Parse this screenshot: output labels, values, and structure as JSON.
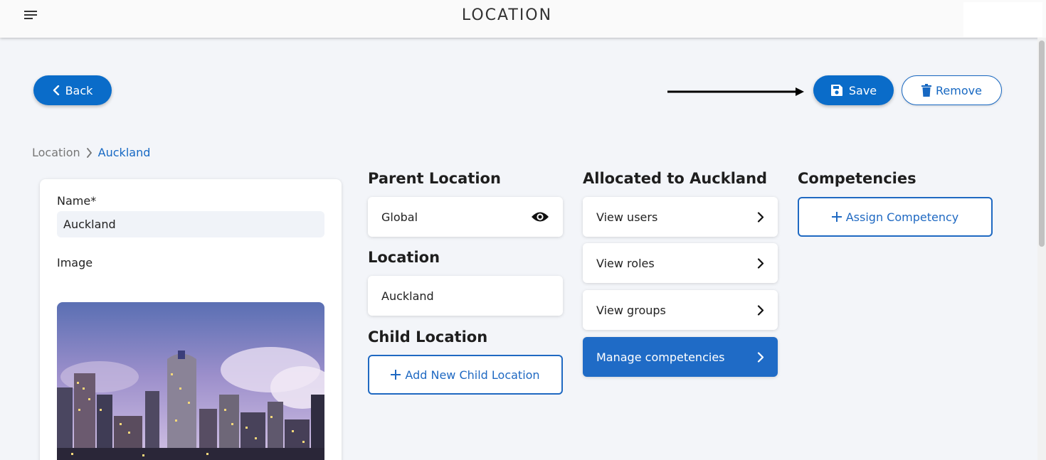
{
  "header": {
    "title": "LOCATION",
    "menu_icon": "hamburger-menu-icon"
  },
  "actions": {
    "back_label": "Back",
    "save_label": "Save",
    "remove_label": "Remove"
  },
  "breadcrumb": {
    "root": "Location",
    "current": "Auckland"
  },
  "details_card": {
    "name_label": "Name*",
    "name_value": "Auckland",
    "image_label": "Image"
  },
  "parent_location": {
    "title": "Parent Location",
    "value": "Global"
  },
  "location": {
    "title": "Location",
    "value": "Auckland"
  },
  "child_location": {
    "title": "Child Location",
    "add_label": "Add New Child Location"
  },
  "allocated": {
    "title": "Allocated to Auckland",
    "items": [
      {
        "label": "View users"
      },
      {
        "label": "View roles"
      },
      {
        "label": "View groups"
      },
      {
        "label": "Manage competencies"
      }
    ]
  },
  "competencies": {
    "title": "Competencies",
    "assign_label": "Assign Competency"
  },
  "colors": {
    "primary": "#0a6cc9",
    "active_tile": "#1f6bc6",
    "background": "#f3f5f9"
  }
}
